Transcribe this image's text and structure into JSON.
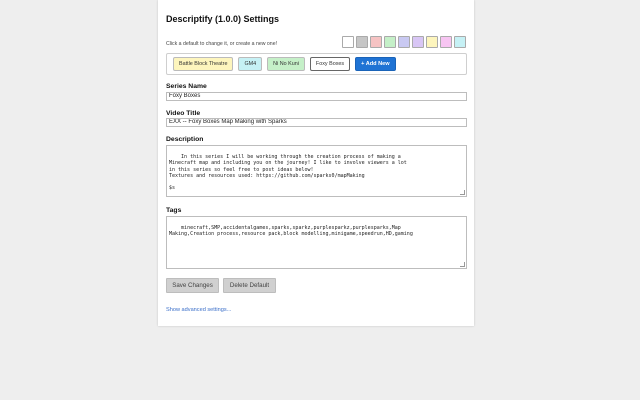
{
  "header": {
    "title": "Descriptify (1.0.0) Settings",
    "hint": "Click a default to change it, or create a new one!"
  },
  "swatches": [
    {
      "color": "#ffffff",
      "name": "white"
    },
    {
      "color": "#c6c6c6",
      "name": "gray"
    },
    {
      "color": "#f6c3c3",
      "name": "pink"
    },
    {
      "color": "#c5f0c8",
      "name": "green"
    },
    {
      "color": "#c9c9f2",
      "name": "blue"
    },
    {
      "color": "#d8c6f5",
      "name": "purple"
    },
    {
      "color": "#fdf5bd",
      "name": "yellow"
    },
    {
      "color": "#f7c5f2",
      "name": "magenta"
    },
    {
      "color": "#c6f1f5",
      "name": "cyan"
    }
  ],
  "defaults": [
    {
      "label": "Battle Block Theatre",
      "color": "#fdf5bd"
    },
    {
      "label": "GM4",
      "color": "#c6f1f5"
    },
    {
      "label": "Ni No Kuni",
      "color": "#c5f0c8"
    },
    {
      "label": "Foxy Boxes",
      "color": "#ffffff"
    }
  ],
  "add_new_label": "+ Add New",
  "form": {
    "series_label": "Series Name",
    "series_value": "Foxy Boxes",
    "video_label": "Video Title",
    "video_value": "EXX -- Foxy Boxes Map Making with Sparks",
    "description_label": "Description",
    "description_value": "In this series I will be working through the creation process of making a\nMinecraft map and including you on the journey! I like to involve viewers a lot\nin this series so feel free to post ideas below!\nTextures and resources used: https://github.com/sparks0/mapMaking\n\n$s",
    "tags_label": "Tags",
    "tags_value": "minecraft,SMP,accidentalgames,sparks,sparkz,purplesparkz,purplesparks,Map\nMaking,Creation process,resource pack,block modelling,minigame,speedrun,HD,gaming"
  },
  "actions": {
    "save_label": "Save Changes",
    "delete_label": "Delete Default",
    "advanced_label": "Show advanced settings..."
  }
}
